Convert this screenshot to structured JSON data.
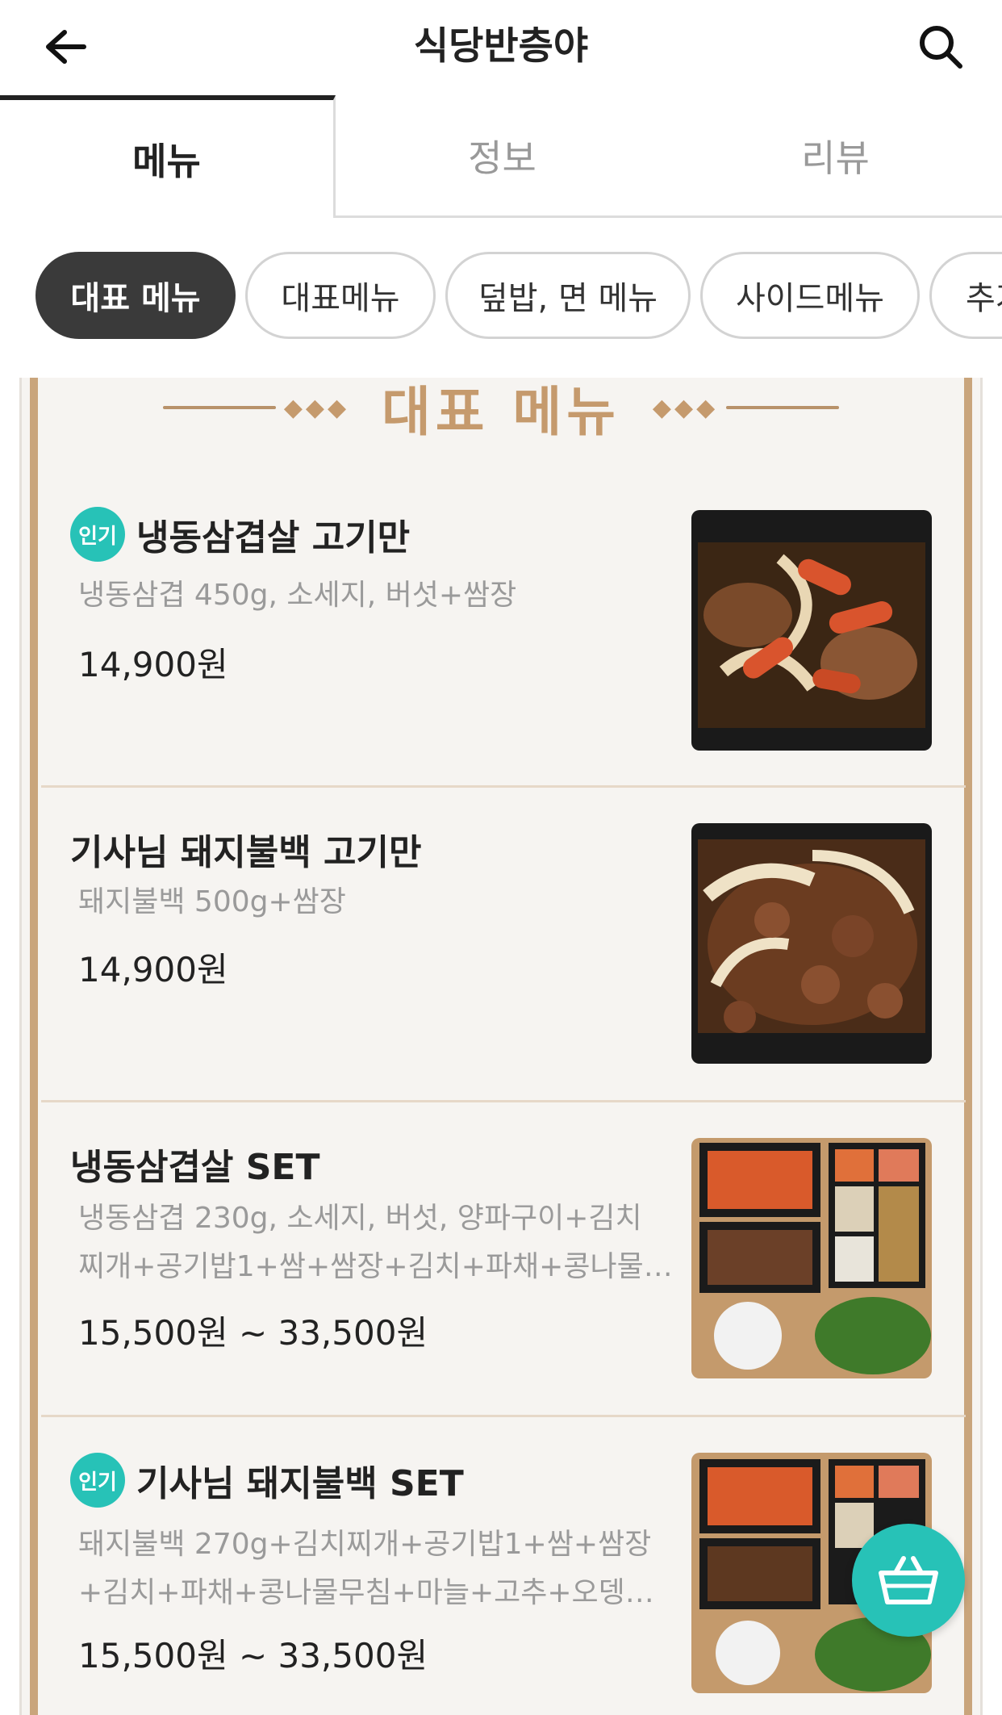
{
  "header": {
    "title": "식당반층야",
    "back_icon": "arrow-left-icon",
    "search_icon": "search-icon"
  },
  "tabs": [
    {
      "label": "메뉴",
      "active": true
    },
    {
      "label": "정보",
      "active": false
    },
    {
      "label": "리뷰",
      "active": false
    }
  ],
  "chips": [
    {
      "label": "대표 메뉴",
      "active": true
    },
    {
      "label": "대표메뉴",
      "active": false
    },
    {
      "label": "덮밥, 면 메뉴",
      "active": false
    },
    {
      "label": "사이드메뉴",
      "active": false
    },
    {
      "label": "추가",
      "active": false
    }
  ],
  "board": {
    "title": "대표 메뉴",
    "accent_color": "#c59a6d"
  },
  "items": [
    {
      "badge": "인기",
      "name": "냉동삼겹살 고기만",
      "desc": "냉동삼겹 450g, 소세지, 버섯+쌈장",
      "price": "14,900원"
    },
    {
      "badge": "",
      "name": "기사님 돼지불백 고기만",
      "desc": "돼지불백 500g+쌈장",
      "price": "14,900원"
    },
    {
      "badge": "",
      "name": "냉동삼겹살 SET",
      "desc_line1": "냉동삼겹 230g, 소세지, 버섯, 양파구이+김치",
      "desc_line2": "찌개+공기밥1+쌈+쌈장+김치+파채+콩나물…",
      "price": "15,500원 ~ 33,500원"
    },
    {
      "badge": "인기",
      "name": "기사님 돼지불백 SET",
      "desc_line1": "돼지불백 270g+김치찌개+공기밥1+쌈+쌈장",
      "desc_line2": "+김치+파채+콩나물무침+마늘+고추+오뎅…",
      "price": "15,500원 ~ 33,500원"
    }
  ],
  "cart": {
    "icon": "shopping-basket-icon",
    "color": "#27c2b7"
  }
}
